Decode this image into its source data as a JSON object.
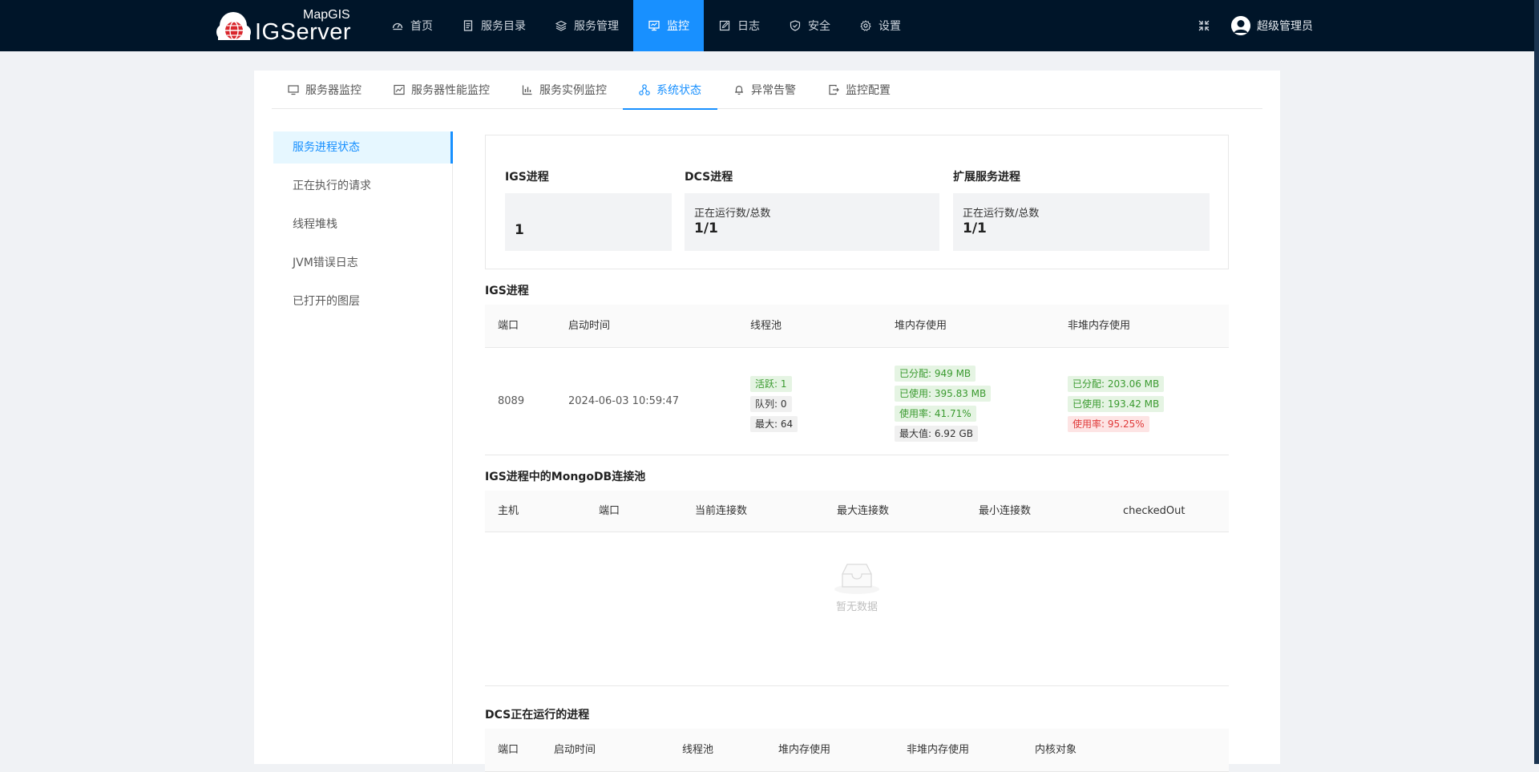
{
  "header": {
    "logo_top": "MapGIS",
    "logo_main": "IGServer",
    "nav": [
      {
        "label": "首页",
        "icon": "dashboard-icon"
      },
      {
        "label": "服务目录",
        "icon": "document-icon"
      },
      {
        "label": "服务管理",
        "icon": "layers-icon"
      },
      {
        "label": "监控",
        "icon": "monitor-icon",
        "active": true
      },
      {
        "label": "日志",
        "icon": "edit-icon"
      },
      {
        "label": "安全",
        "icon": "shield-icon"
      },
      {
        "label": "设置",
        "icon": "gear-icon"
      }
    ],
    "user": "超级管理员"
  },
  "tabs": [
    {
      "label": "服务器监控",
      "icon": "desktop-icon"
    },
    {
      "label": "服务器性能监控",
      "icon": "line-chart-icon"
    },
    {
      "label": "服务实例监控",
      "icon": "bar-chart-icon"
    },
    {
      "label": "系统状态",
      "icon": "cluster-icon",
      "active": true
    },
    {
      "label": "异常告警",
      "icon": "bell-icon"
    },
    {
      "label": "监控配置",
      "icon": "export-icon"
    }
  ],
  "side_menu": [
    {
      "label": "服务进程状态",
      "active": true
    },
    {
      "label": "正在执行的请求"
    },
    {
      "label": "线程堆栈"
    },
    {
      "label": "JVM错误日志"
    },
    {
      "label": "已打开的图层"
    }
  ],
  "summary": {
    "igs": {
      "title": "IGS进程",
      "value": "1"
    },
    "dcs": {
      "title": "DCS进程",
      "label": "正在运行数/总数",
      "value": "1/1"
    },
    "ext": {
      "title": "扩展服务进程",
      "label": "正在运行数/总数",
      "value": "1/1"
    }
  },
  "igs_table": {
    "title": "IGS进程",
    "columns": [
      "端口",
      "启动时间",
      "线程池",
      "堆内存使用",
      "非堆内存使用"
    ],
    "row": {
      "port": "8089",
      "start_time": "2024-06-03 10:59:47",
      "thread_pool": {
        "active": "活跃: 1",
        "queue": "队列: 0",
        "max": "最大: 64"
      },
      "heap": {
        "allocated": "已分配: 949 MB",
        "used": "已使用: 395.83 MB",
        "rate": "使用率: 41.71%",
        "max": "最大值: 6.92 GB"
      },
      "nonheap": {
        "allocated": "已分配: 203.06 MB",
        "used": "已使用: 193.42 MB",
        "rate": "使用率: 95.25%"
      }
    }
  },
  "mongo_table": {
    "title": "IGS进程中的MongoDB连接池",
    "columns": [
      "主机",
      "端口",
      "当前连接数",
      "最大连接数",
      "最小连接数",
      "checkedOut"
    ],
    "empty_text": "暂无数据"
  },
  "dcs_table": {
    "title": "DCS正在运行的进程",
    "columns": [
      "端口",
      "启动时间",
      "线程池",
      "堆内存使用",
      "非堆内存使用",
      "内核对象"
    ]
  }
}
